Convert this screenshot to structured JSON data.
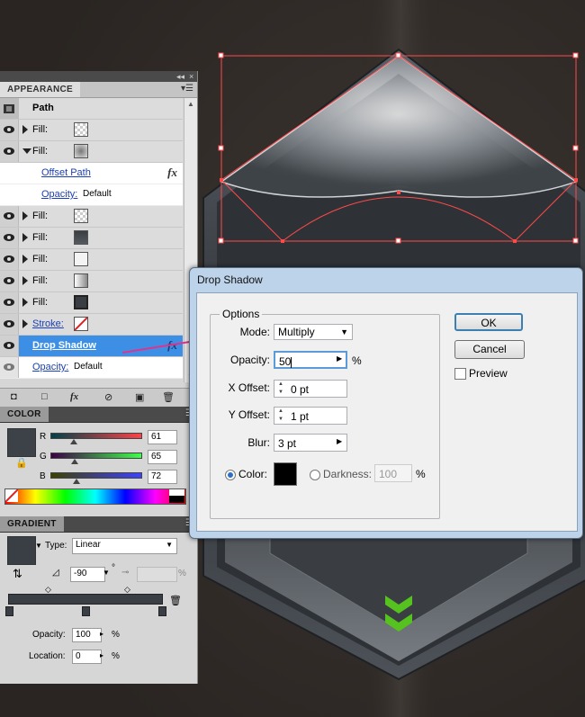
{
  "appearance": {
    "tab": "APPEARANCE",
    "path_label": "Path",
    "rows": [
      {
        "label": "Fill:"
      },
      {
        "label": "Fill:"
      },
      {
        "label": "Offset Path"
      },
      {
        "label": "Opacity:",
        "value": "Default"
      },
      {
        "label": "Fill:"
      },
      {
        "label": "Fill:"
      },
      {
        "label": "Fill:"
      },
      {
        "label": "Fill:"
      },
      {
        "label": "Fill:"
      },
      {
        "label": "Stroke:"
      },
      {
        "label": "Drop Shadow"
      },
      {
        "label": "Opacity:",
        "value": "Default"
      }
    ],
    "fx_symbol": "fx"
  },
  "color_panel": {
    "tab": "COLOR",
    "r_label": "R",
    "r_value": "61",
    "g_label": "G",
    "g_value": "65",
    "b_label": "B",
    "b_value": "72",
    "swatch_color": "#3d4148"
  },
  "gradient_panel": {
    "tab": "GRADIENT",
    "type_label": "Type:",
    "type_value": "Linear",
    "angle_value": "-90",
    "angle_unit": "°",
    "aspect_unit": "%",
    "opacity_label": "Opacity:",
    "opacity_value": "100",
    "location_label": "Location:",
    "location_value": "0",
    "percent": "%"
  },
  "dialog": {
    "title": "Drop Shadow",
    "options_title": "Options",
    "mode_label": "Mode:",
    "mode_value": "Multiply",
    "opacity_label": "Opacity:",
    "opacity_value": "50",
    "opacity_unit": "%",
    "x_offset_label": "X Offset:",
    "x_offset_value": "0 pt",
    "y_offset_label": "Y Offset:",
    "y_offset_value": "1 pt",
    "blur_label": "Blur:",
    "blur_value": "3 pt",
    "color_label": "Color:",
    "darkness_label": "Darkness:",
    "darkness_value": "100",
    "darkness_unit": "%",
    "ok_label": "OK",
    "cancel_label": "Cancel",
    "preview_label": "Preview",
    "shadow_color": "#000000"
  },
  "colors": {
    "selection": "#ff4a4a",
    "selected_row": "#3d8fe5",
    "arrow": "#e0338c",
    "green_icon": "#4fb81c"
  }
}
